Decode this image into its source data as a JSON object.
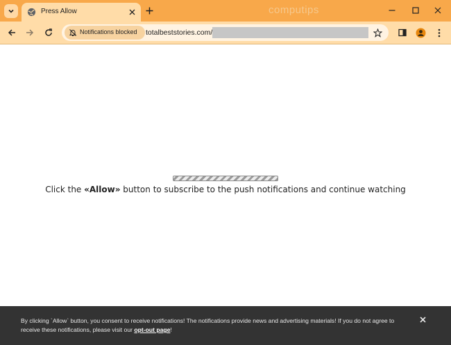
{
  "browser": {
    "tab": {
      "title": "Press Allow"
    },
    "watermark": "computips",
    "address_bar": {
      "notification_chip": "Notifications blocked",
      "url": "totalbeststories.com/"
    }
  },
  "page": {
    "message": {
      "prefix": "Click the ",
      "bold": "«Allow»",
      "suffix": " button to subscribe to the push notifications and continue watching"
    }
  },
  "consent_bar": {
    "text_before_link": "By clicking `Allow` button, you consent to receive notifications! The notifications provide news and advertising materials! If you do not agree to receive these notifications, please visit our ",
    "link_text": "opt-out page",
    "text_after_link": "!"
  },
  "colors": {
    "tab_strip": "#f8a84a",
    "toolbar": "#ffdca8",
    "consent_bg": "#333333"
  },
  "icons": [
    "tab-search-icon",
    "globe-icon",
    "close-icon",
    "plus-icon",
    "minimize-icon",
    "maximize-icon",
    "back-arrow-icon",
    "forward-arrow-icon",
    "reload-icon",
    "bell-off-icon",
    "star-icon",
    "side-panel-icon",
    "profile-icon",
    "menu-dots-icon"
  ]
}
